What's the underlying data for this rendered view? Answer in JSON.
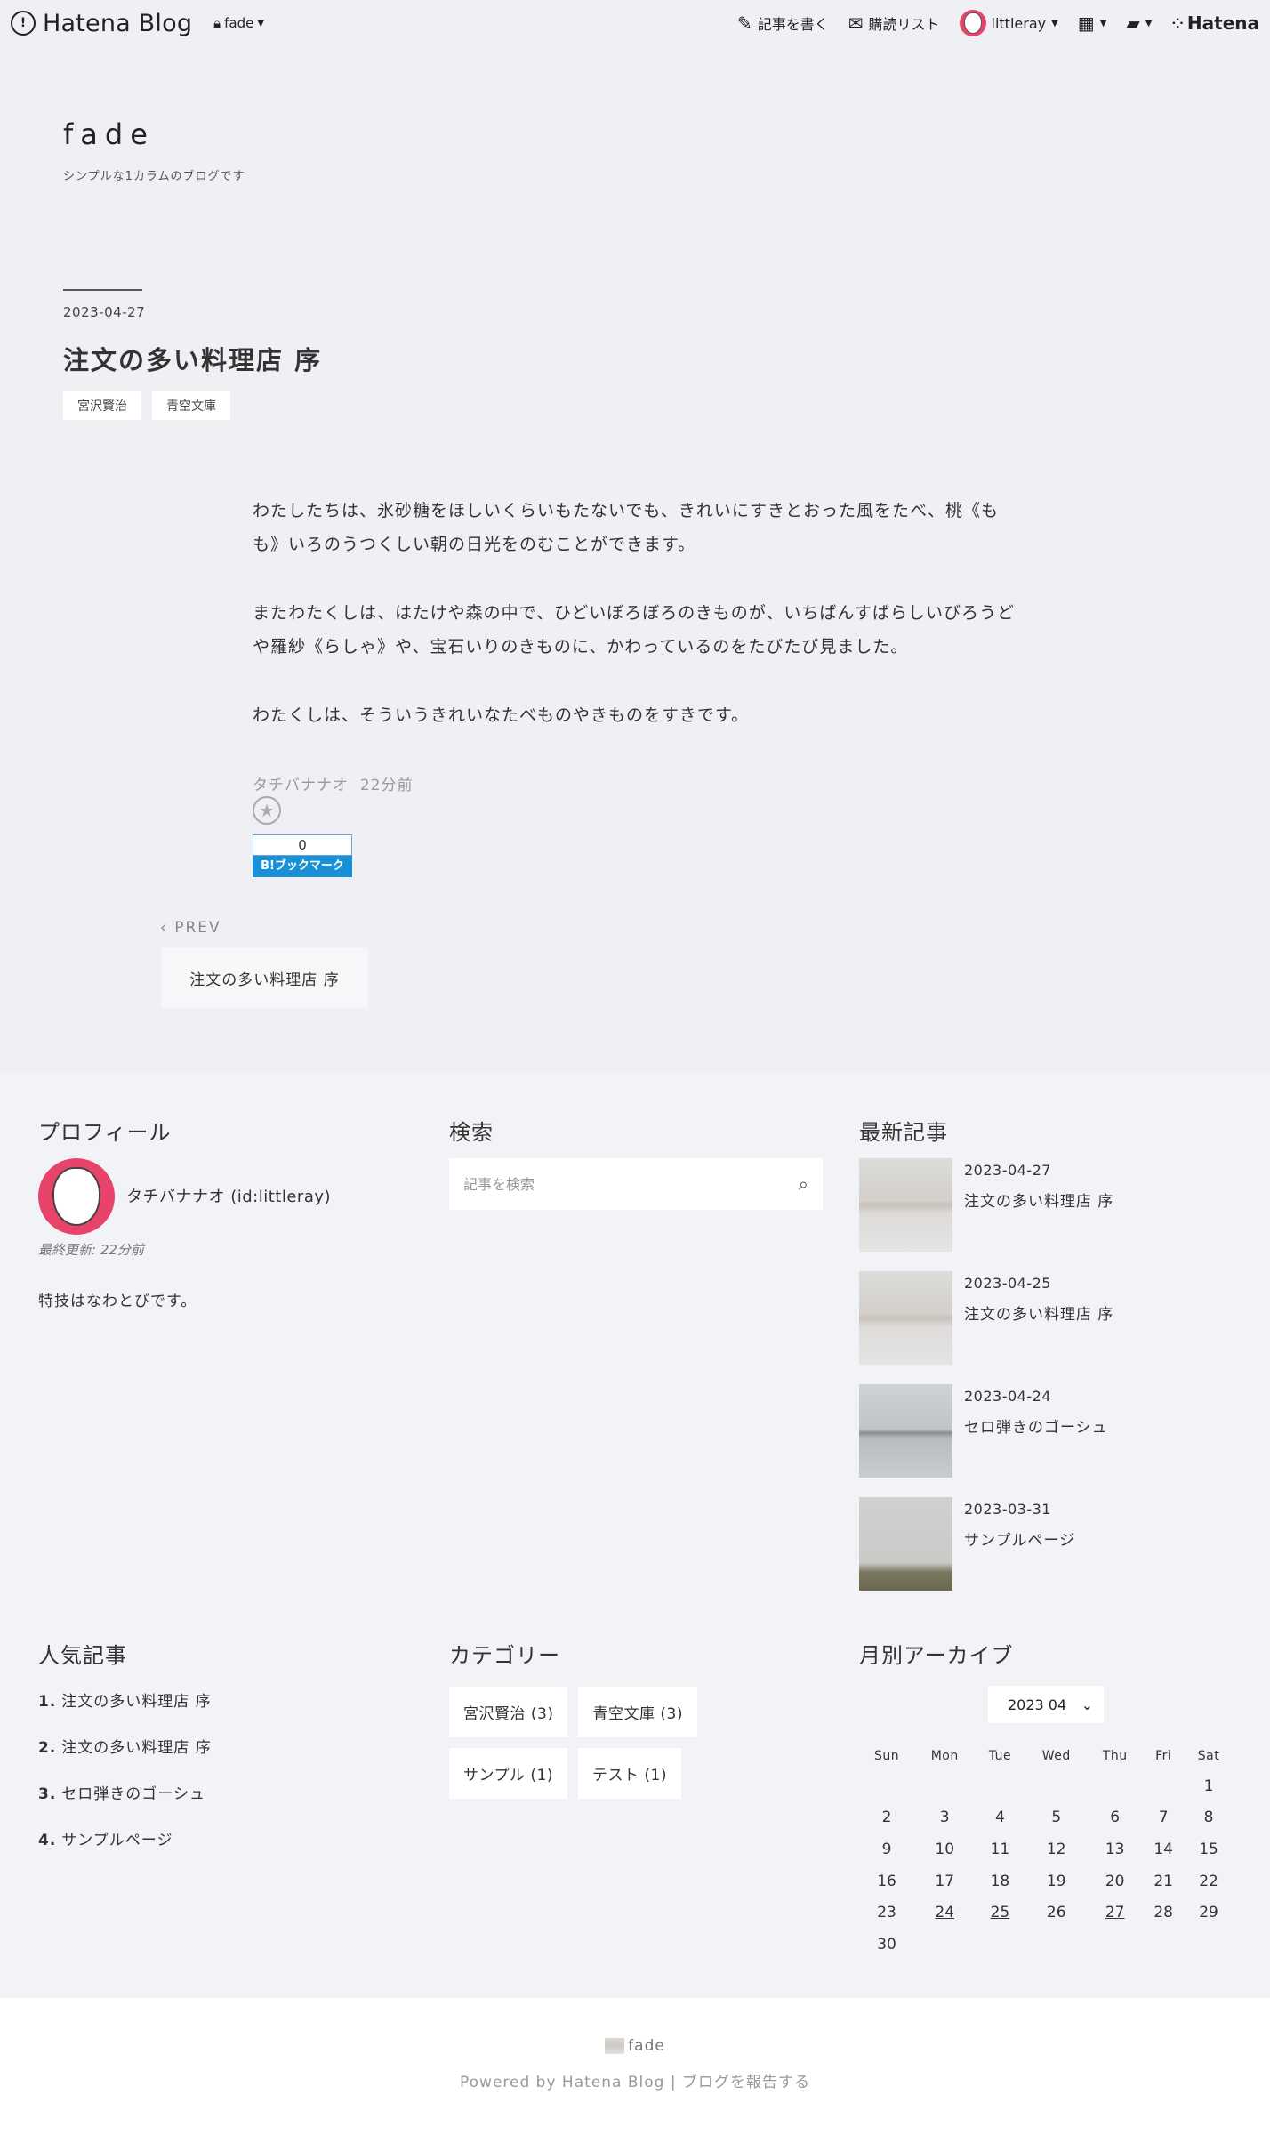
{
  "topbar": {
    "logo_text": "Hatena Blog",
    "blog_selector": "fade",
    "write_label": "記事を書く",
    "reading_list_label": "購読リスト",
    "user_name": "littleray",
    "brand_text": "Hatena",
    "icons": [
      "hatena-logo-icon",
      "lock-icon",
      "edit-icon",
      "reading-list-icon",
      "apps-grid-icon",
      "notification-icon"
    ]
  },
  "blog": {
    "title": "fade",
    "description": "シンプルな1カラムのブログです"
  },
  "article": {
    "date": "2023-04-27",
    "title": "注文の多い料理店 序",
    "tags": [
      "宮沢賢治",
      "青空文庫"
    ],
    "paragraphs": [
      "わたしたちは、氷砂糖をほしいくらいもたないでも、きれいにすきとおった風をたべ、桃《もも》いろのうつくしい朝の日光をのむことができます。",
      "またわたくしは、はたけや森の中で、ひどいぼろぼろのきものが、いちばんすばらしいびろうどや羅紗《らしゃ》や、宝石いりのきものに、かわっているのをたびたび見ました。",
      "わたくしは、そういうきれいなたべものやきものをすきです。"
    ],
    "author": "タチバナナオ",
    "posted_ago": "22分前",
    "bookmark_count": "0",
    "bookmark_label": "B!ブックマーク"
  },
  "pager": {
    "prev_label": "PREV",
    "prev_title": "注文の多い料理店 序"
  },
  "modules": {
    "profile": {
      "heading": "プロフィール",
      "name": "タチバナナオ (id:littleray)",
      "updated": "最終更新: 22分前",
      "description": "特技はなわとびです。"
    },
    "search": {
      "heading": "検索",
      "placeholder": "記事を検索"
    },
    "recent": {
      "heading": "最新記事",
      "items": [
        {
          "date": "2023-04-27",
          "title": "注文の多い料理店 序"
        },
        {
          "date": "2023-04-25",
          "title": "注文の多い料理店 序"
        },
        {
          "date": "2023-04-24",
          "title": "セロ弾きのゴーシュ"
        },
        {
          "date": "2023-03-31",
          "title": "サンプルページ"
        }
      ]
    },
    "popular": {
      "heading": "人気記事",
      "items": [
        {
          "rank": "1.",
          "title": "注文の多い料理店 序"
        },
        {
          "rank": "2.",
          "title": "注文の多い料理店 序"
        },
        {
          "rank": "3.",
          "title": "セロ弾きのゴーシュ"
        },
        {
          "rank": "4.",
          "title": "サンプルページ"
        }
      ]
    },
    "categories": {
      "heading": "カテゴリー",
      "items": [
        "宮沢賢治 (3)",
        "青空文庫 (3)",
        "サンプル (1)",
        "テスト (1)"
      ]
    },
    "archive": {
      "heading": "月別アーカイブ",
      "selected_month": "2023 04",
      "weekdays": [
        "Sun",
        "Mon",
        "Tue",
        "Wed",
        "Thu",
        "Fri",
        "Sat"
      ],
      "weeks": [
        [
          "",
          "",
          "",
          "",
          "",
          "",
          "1"
        ],
        [
          "2",
          "3",
          "4",
          "5",
          "6",
          "7",
          "8"
        ],
        [
          "9",
          "10",
          "11",
          "12",
          "13",
          "14",
          "15"
        ],
        [
          "16",
          "17",
          "18",
          "19",
          "20",
          "21",
          "22"
        ],
        [
          "23",
          "24",
          "25",
          "26",
          "27",
          "28",
          "29"
        ],
        [
          "30",
          "",
          "",
          "",
          "",
          "",
          ""
        ]
      ],
      "linked_days": [
        "24",
        "25",
        "27"
      ]
    }
  },
  "footer": {
    "blog_name": "fade",
    "powered_by": "Powered by Hatena Blog",
    "separator": "|",
    "report_label": "ブログを報告する"
  },
  "colors": {
    "page_bg": "#eef0f4",
    "bookmark_blue": "#1a90d6",
    "avatar_pink": "#e8436a"
  }
}
